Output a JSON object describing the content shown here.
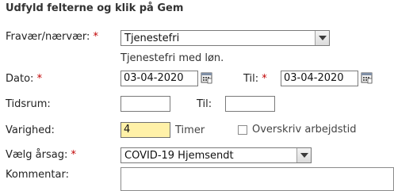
{
  "form": {
    "heading": "Udfyld felterne og klik på Gem",
    "required_marker": "*",
    "absence": {
      "label": "Fravær/nærvær:",
      "selected": "Tjenestefri",
      "hint": "Tjenestefri med løn."
    },
    "date": {
      "label": "Dato:",
      "from_value": "03-04-2020",
      "to_label": "Til:",
      "to_value": "03-04-2020"
    },
    "timespan": {
      "label": "Tidsrum:",
      "from_value": "",
      "to_label": "Til:",
      "to_value": ""
    },
    "duration": {
      "label": "Varighed:",
      "value": "4",
      "unit": "Timer",
      "override_label": "Overskriv arbejdstid",
      "override_checked": false
    },
    "reason": {
      "label": "Vælg årsag:",
      "selected": "COVID-19 Hjemsendt"
    },
    "comment": {
      "label": "Kommentar:",
      "value": ""
    }
  }
}
